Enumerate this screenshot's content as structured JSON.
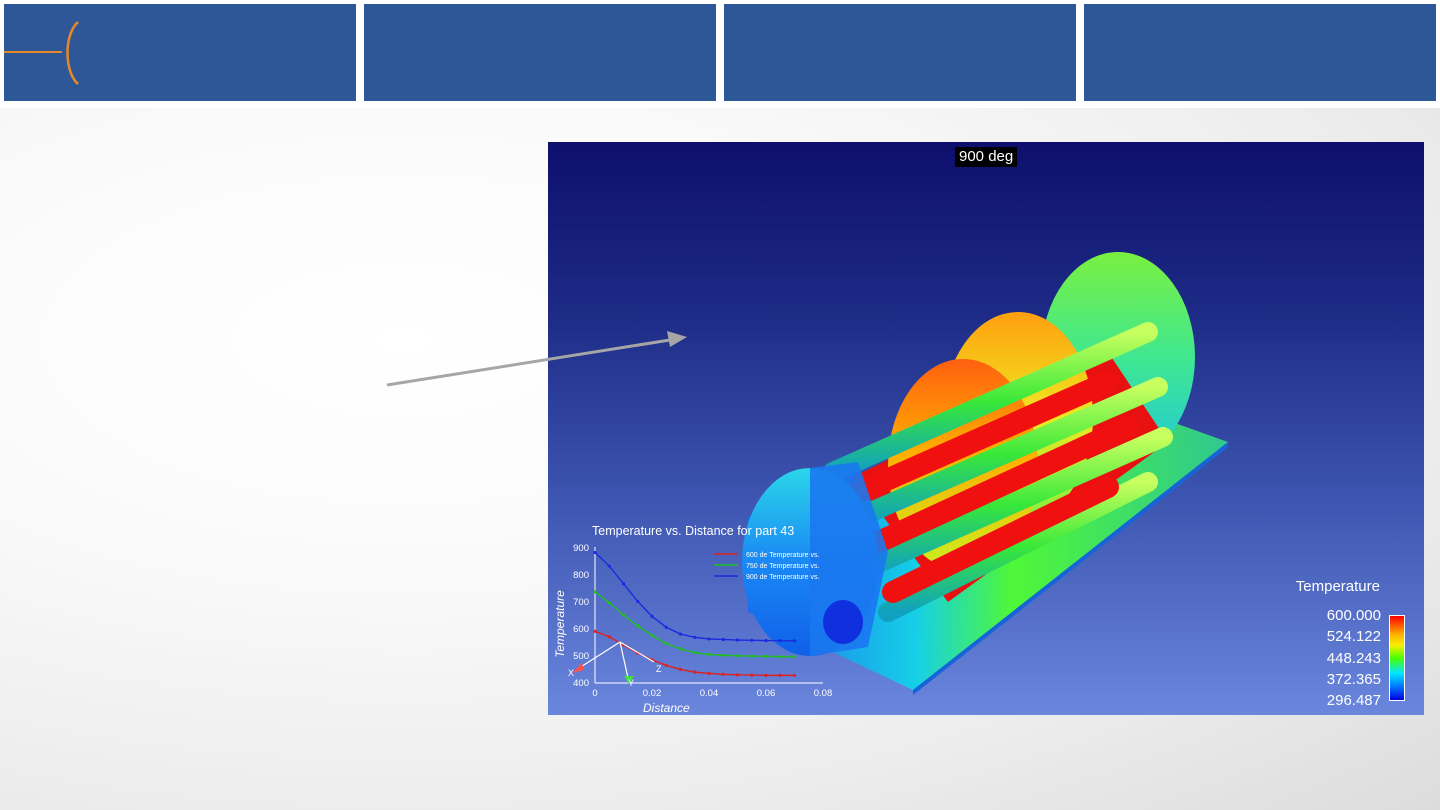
{
  "screenshot": {
    "scene_title": "900 deg",
    "legend": {
      "title": "Temperature",
      "values": [
        "600.000",
        "524.122",
        "448.243",
        "372.365",
        "296.487"
      ]
    },
    "plot": {
      "title": "Temperature vs. Distance for part 43",
      "xlabel": "Distance",
      "ylabel": "Temperature",
      "x_ticks": [
        "0",
        "0.02",
        "0.04",
        "0.06",
        "0.08"
      ],
      "y_ticks": [
        "900",
        "800",
        "700",
        "600",
        "500",
        "400"
      ],
      "series_labels": [
        "600 de  Temperature vs.",
        "750 de  Temperature vs.",
        "900 de  Temperature vs."
      ],
      "axis_triad": [
        "X",
        "Y",
        "Z"
      ]
    }
  },
  "chart_data": {
    "type": "line",
    "title": "Temperature vs. Distance for part 43",
    "xlabel": "Distance",
    "ylabel": "Temperature",
    "xlim": [
      0,
      0.08
    ],
    "ylim": [
      400,
      900
    ],
    "x": [
      0,
      0.005,
      0.01,
      0.015,
      0.02,
      0.025,
      0.03,
      0.035,
      0.04,
      0.045,
      0.05,
      0.055,
      0.06,
      0.065,
      0.07
    ],
    "series": [
      {
        "name": "600 de  Temperature vs.",
        "color": "#e02020",
        "values": [
          590,
          570,
          540,
          510,
          485,
          465,
          450,
          440,
          435,
          432,
          430,
          429,
          428,
          428,
          428
        ]
      },
      {
        "name": "750 de  Temperature vs.",
        "color": "#20c020",
        "values": [
          735,
          695,
          650,
          610,
          575,
          545,
          525,
          512,
          505,
          502,
          500,
          499,
          498,
          497,
          497
        ]
      },
      {
        "name": "900 de  Temperature vs.",
        "color": "#1a2ae0",
        "values": [
          880,
          830,
          765,
          700,
          645,
          605,
          580,
          568,
          562,
          560,
          558,
          557,
          556,
          556,
          555
        ]
      }
    ],
    "grid": false,
    "legend": "top-right"
  }
}
